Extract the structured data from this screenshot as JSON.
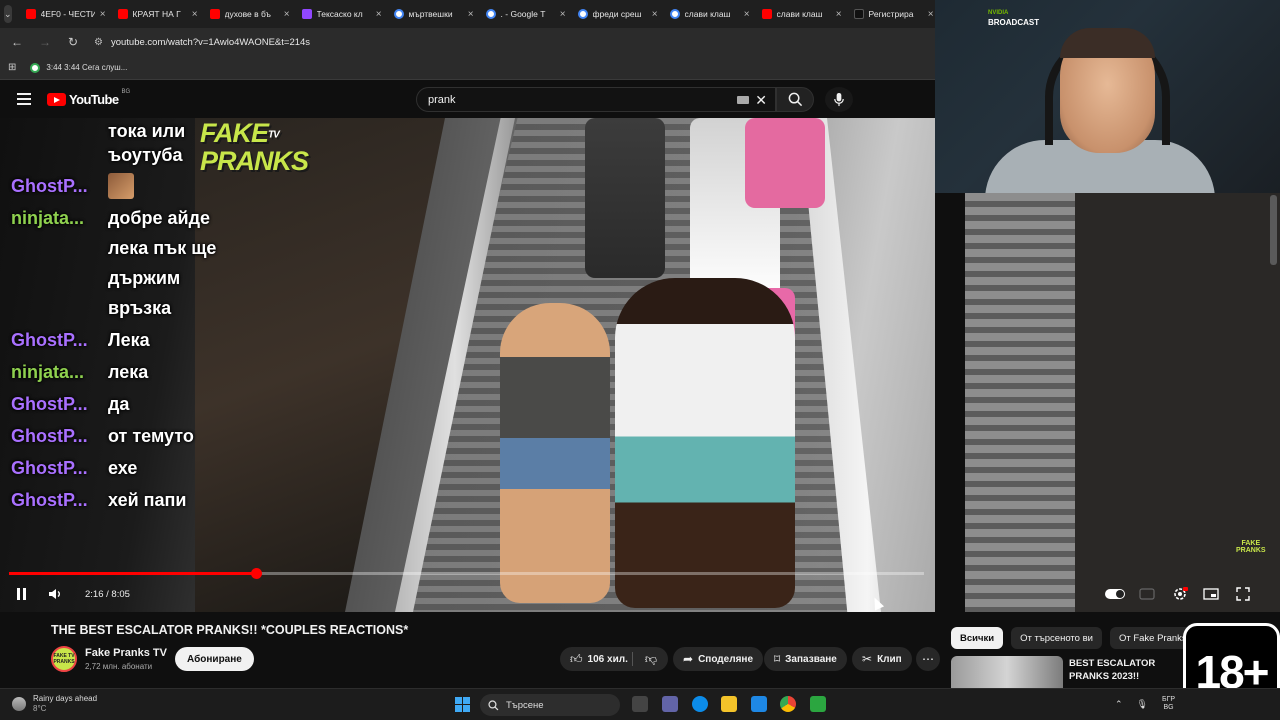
{
  "browser": {
    "tabs": [
      {
        "label": "4EF0 - ЧЕСТИ",
        "icon": "youtube-icon"
      },
      {
        "label": "КРАЯТ НА Г",
        "icon": "youtube-icon"
      },
      {
        "label": "духове в бъ",
        "icon": "youtube-icon"
      },
      {
        "label": "Тексаско кл",
        "icon": "twitch-icon"
      },
      {
        "label": "мъртвешки",
        "icon": "google-icon"
      },
      {
        "label": ". - Google Т",
        "icon": "google-icon"
      },
      {
        "label": "фреди среш",
        "icon": "google-icon"
      },
      {
        "label": "слави клаш",
        "icon": "google-icon"
      },
      {
        "label": "слави клаш",
        "icon": "youtube-icon"
      },
      {
        "label": "Регистрира",
        "icon": "tiktok-icon"
      }
    ],
    "tab_close": "×",
    "url": "youtube.com/watch?v=1Awlo4WAONE&t=214s",
    "bookmark": "3:44 3:44 Сега слуш..."
  },
  "youtube": {
    "logo_text": "YouTube",
    "country_code": "BG",
    "search_value": "prank",
    "clear_glyph": "✕"
  },
  "video": {
    "watermark_line1": "FAKE",
    "watermark_tv": "TV",
    "watermark_line2": "PRANKS",
    "corner_mark_line1": "FAKE",
    "corner_mark_line2": "PRANKS",
    "progress": 0.27,
    "time": "2:16 / 8:05"
  },
  "chat": [
    {
      "user": "",
      "message": "тока или"
    },
    {
      "user": "",
      "message": "ъоутуба"
    },
    {
      "user": "GhostP...",
      "message": "",
      "emote": true
    },
    {
      "user": "ninjata...",
      "message": "добре айде"
    },
    {
      "user": "",
      "message": "лека пък ще"
    },
    {
      "user": "",
      "message": "държим"
    },
    {
      "user": "",
      "message": "връзка"
    },
    {
      "user": "GhostP...",
      "message": "Лека"
    },
    {
      "user": "ninjata...",
      "message": "лека"
    },
    {
      "user": "GhostP...",
      "message": "да"
    },
    {
      "user": "GhostP...",
      "message": "от темуто"
    },
    {
      "user": "GhostP...",
      "message": "ехе"
    },
    {
      "user": "GhostP...",
      "message": "хей папи"
    }
  ],
  "webcam": {
    "brand_vendor": "NVIDIA",
    "brand_name": "BROADCAST"
  },
  "details": {
    "title": "THE BEST ESCALATOR PRANKS!! *COUPLES REACTIONS*",
    "channel": "Fake Pranks TV",
    "channel_avatar_text": "FAKE TV PRANKS",
    "subscribers": "2,72 млн. абонати",
    "subscribe": "Абониране",
    "likes": "106 хил.",
    "share": "Споделяне",
    "save": "Запазване",
    "clip": "Клип",
    "more": "⋯"
  },
  "recommendations": {
    "chips": [
      "Всички",
      "От търсеното ви",
      "От Fake Pranks TV"
    ],
    "first_title": "BEST ESCALATOR PRANKS 2023!!"
  },
  "age_badge": "18+",
  "taskbar": {
    "weather_title": "Rainy days ahead",
    "weather_temp": "8°C",
    "search_placeholder": "Търсене",
    "lang_line1": "БГР",
    "lang_line2": "BG"
  },
  "colors": {
    "youtube_red": "#ff0000",
    "chat_ghost": "#a970ff",
    "chat_ninja": "#8fd14f",
    "watermark": "#c8e64a"
  }
}
